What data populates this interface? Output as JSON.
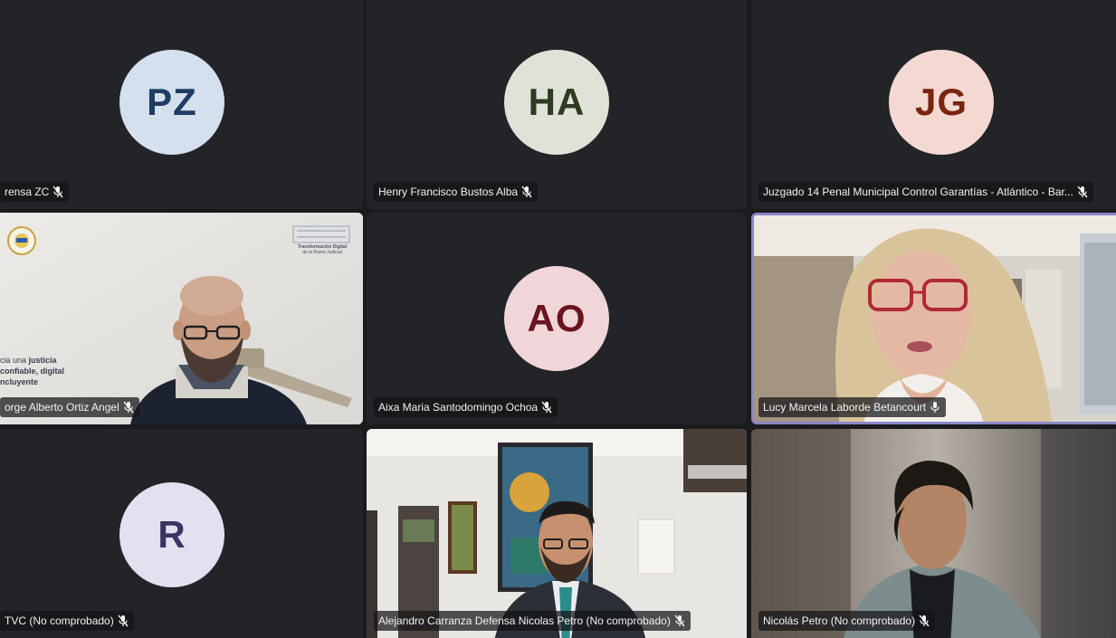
{
  "tiles": [
    {
      "initials": "PZ",
      "name": "rensa ZC",
      "mic": "muted",
      "avatar_bg": "#d4e0ee",
      "avatar_fg": "#1f3c64"
    },
    {
      "initials": "HA",
      "name": "Henry Francisco Bustos Alba",
      "mic": "muted",
      "avatar_bg": "#dfe3d7",
      "avatar_fg": "#2f3a22"
    },
    {
      "initials": "JG",
      "name": "Juzgado 14 Penal Municipal Control Garantías - Atlántico - Bar...",
      "mic": "muted",
      "avatar_bg": "#f3d9d2",
      "avatar_fg": "#7a2411"
    },
    {
      "name": "orge Alberto Ortiz Angel",
      "mic": "muted",
      "video": true
    },
    {
      "initials": "AO",
      "name": "Aixa Maria Santodomingo Ochoa",
      "mic": "muted",
      "avatar_bg": "#f0d6d8",
      "avatar_fg": "#6b1420"
    },
    {
      "name": "Lucy Marcela Laborde Betancourt",
      "mic": "on",
      "video": true,
      "speaking": true
    },
    {
      "initials": "R",
      "name": "TVC (No comprobado)",
      "mic": "muted",
      "avatar_bg": "#e4e0ef",
      "avatar_fg": "#3a3560"
    },
    {
      "name": "Alejandro Carranza Defensa Nicolas Petro (No comprobado)",
      "mic": "muted",
      "video": true
    },
    {
      "name": "Nicolás Petro (No comprobado)",
      "mic": "muted",
      "video": true
    }
  ],
  "slide_text": {
    "line1_prefix": "cia una ",
    "line1_bold": "justicia",
    "line2": "confiable, digital",
    "line3": "ncluyente",
    "logo_title": "Transformación Digital",
    "logo_sub": "de la Rama Judicial"
  },
  "colors": {
    "background": "#1a1b1d",
    "tile": "#232427",
    "speaking_border": "#8b86c9"
  }
}
